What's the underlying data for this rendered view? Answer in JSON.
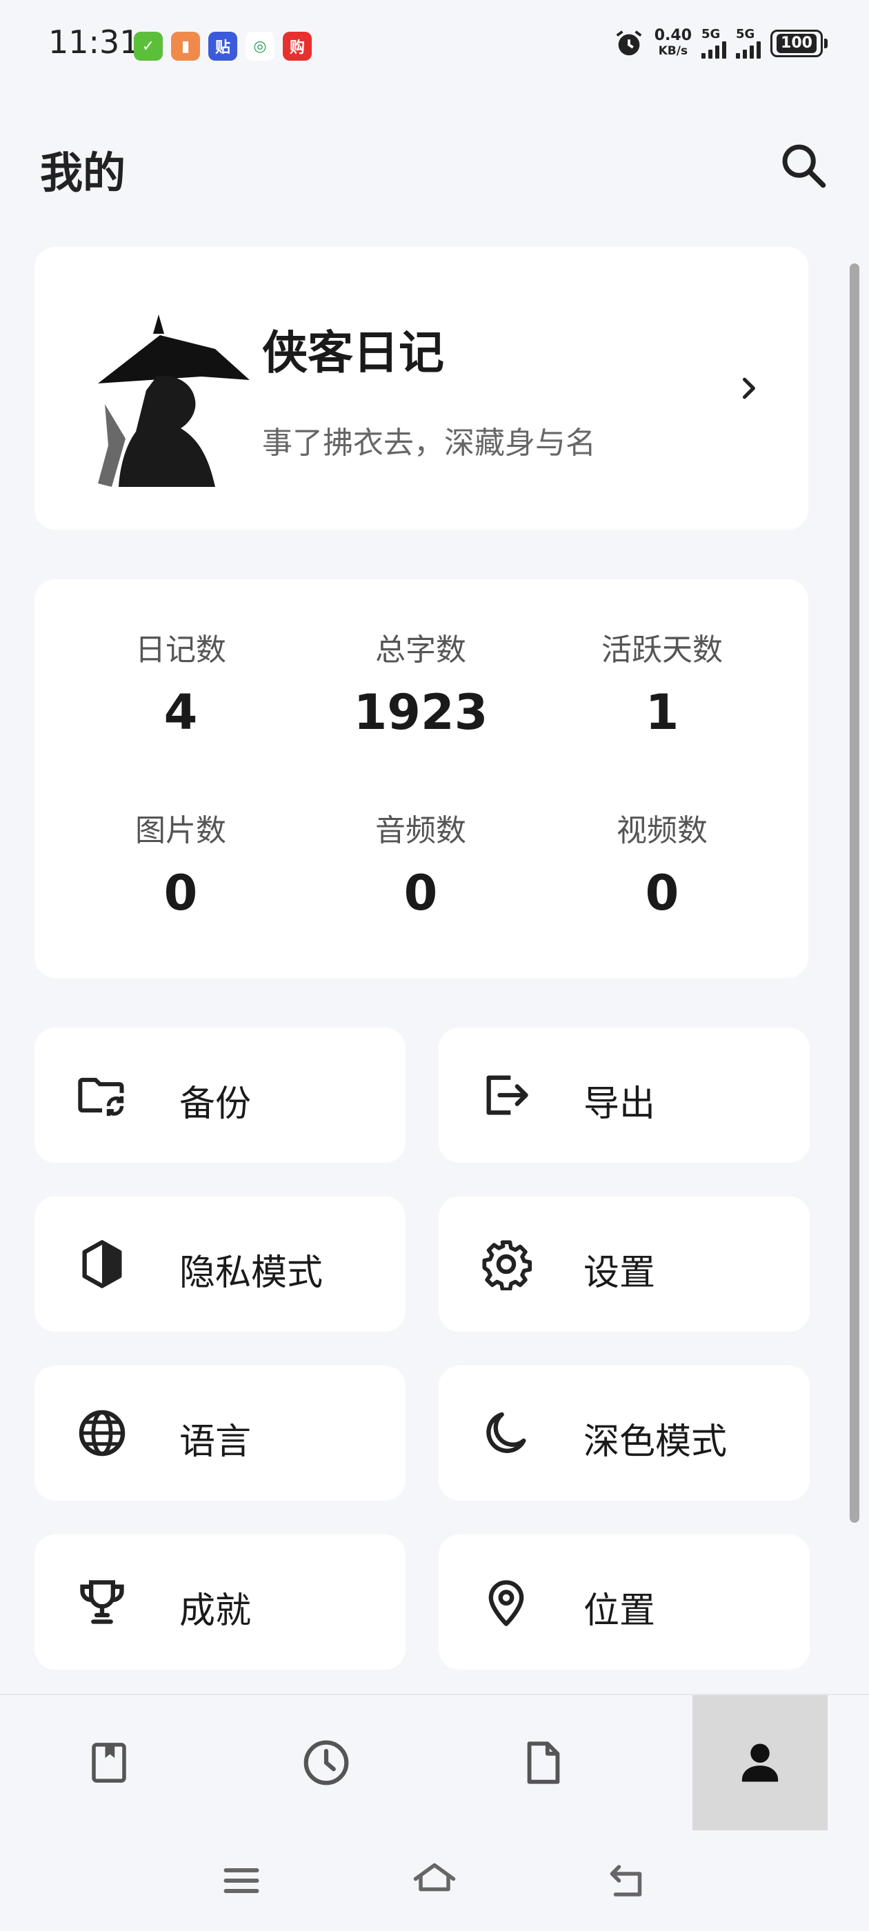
{
  "status_bar": {
    "time": "11:31",
    "net_speed_value": "0.40",
    "net_speed_unit": "KB/s",
    "signal1_label": "5G",
    "signal2_label": "5G",
    "battery": "100",
    "app_icons": [
      {
        "name": "check-app-icon",
        "color": "#5bbf3a",
        "glyph": "✓"
      },
      {
        "name": "brush-app-icon",
        "color": "#f08a4b",
        "glyph": "▮"
      },
      {
        "name": "tieba-app-icon",
        "color": "#3b5bdb",
        "glyph": "贴"
      },
      {
        "name": "china-mobile-icon",
        "color": "#ffffff",
        "glyph": "◎"
      },
      {
        "name": "shopping-app-icon",
        "color": "#e8302f",
        "glyph": "购"
      }
    ]
  },
  "header": {
    "title": "我的"
  },
  "profile": {
    "name": "侠客日记",
    "motto": "事了拂衣去，深藏身与名"
  },
  "stats": [
    {
      "label": "日记数",
      "value": "4"
    },
    {
      "label": "总字数",
      "value": "1923"
    },
    {
      "label": "活跃天数",
      "value": "1"
    },
    {
      "label": "图片数",
      "value": "0"
    },
    {
      "label": "音频数",
      "value": "0"
    },
    {
      "label": "视频数",
      "value": "0"
    }
  ],
  "menu": [
    {
      "label": "备份",
      "icon": "folder-sync-icon"
    },
    {
      "label": "导出",
      "icon": "export-icon"
    },
    {
      "label": "隐私模式",
      "icon": "privacy-shield-icon"
    },
    {
      "label": "设置",
      "icon": "gear-icon"
    },
    {
      "label": "语言",
      "icon": "globe-icon"
    },
    {
      "label": "深色模式",
      "icon": "moon-icon"
    },
    {
      "label": "成就",
      "icon": "trophy-icon"
    },
    {
      "label": "位置",
      "icon": "location-pin-icon"
    }
  ],
  "bottom_nav": [
    {
      "icon": "diary-book-icon",
      "active": false
    },
    {
      "icon": "clock-icon",
      "active": false
    },
    {
      "icon": "document-icon",
      "active": false
    },
    {
      "icon": "person-icon",
      "active": true
    }
  ]
}
